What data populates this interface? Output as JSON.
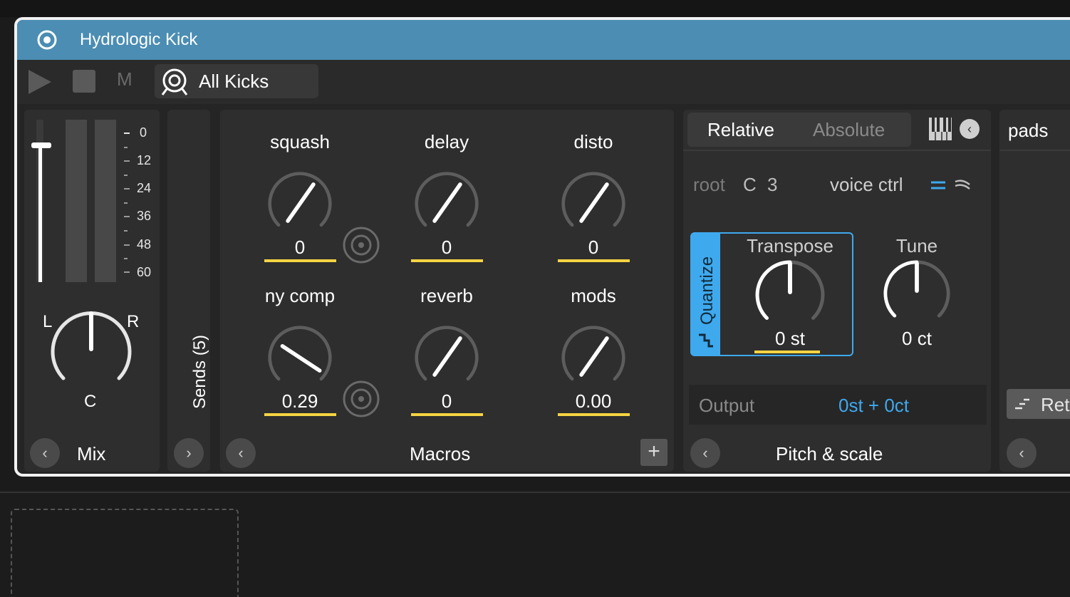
{
  "device": {
    "title": "Hydrologic Kick",
    "preset_name": "All Kicks",
    "mute_label": "M"
  },
  "mix": {
    "label": "Mix",
    "scale": [
      "0",
      "12",
      "24",
      "36",
      "48",
      "60"
    ],
    "pan_left": "L",
    "pan_right": "R",
    "pan_center": "C"
  },
  "sends": {
    "label": "Sends (5)"
  },
  "macros": {
    "label": "Macros",
    "add_label": "+",
    "knobs": [
      {
        "name": "squash",
        "value": "0"
      },
      {
        "name": "delay",
        "value": "0"
      },
      {
        "name": "disto",
        "value": "0"
      },
      {
        "name": "ny comp",
        "value": "0.29"
      },
      {
        "name": "reverb",
        "value": "0"
      },
      {
        "name": "mods",
        "value": "0.00"
      }
    ]
  },
  "pitch": {
    "label": "Pitch & scale",
    "tab_relative": "Relative",
    "tab_absolute": "Absolute",
    "root_label": "root",
    "root_note": "C",
    "root_octave": "3",
    "voice_ctrl_label": "voice ctrl",
    "quantize_label": "Quantize",
    "transpose_label": "Transpose",
    "transpose_value": "0 st",
    "tune_label": "Tune",
    "tune_value": "0 ct",
    "output_label": "Output",
    "output_value": "0st + 0ct"
  },
  "pads": {
    "label": "pads",
    "retrigger_partial": "Ret"
  },
  "colors": {
    "title_bar": "#4b8db3",
    "accent": "#3fa9ee",
    "value_underline": "#f5d442",
    "panel": "#2e2e2e"
  }
}
